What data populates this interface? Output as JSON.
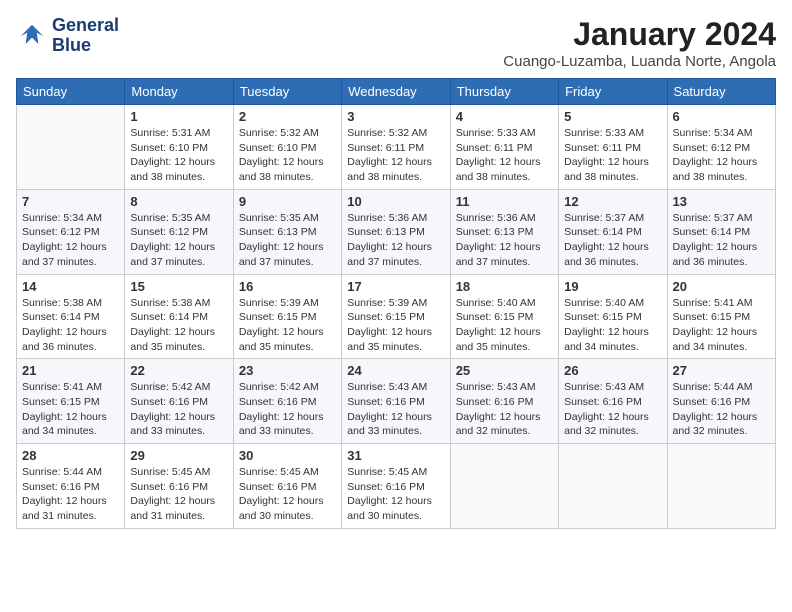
{
  "logo": {
    "line1": "General",
    "line2": "Blue"
  },
  "title": "January 2024",
  "location": "Cuango-Luzamba, Luanda Norte, Angola",
  "days_of_week": [
    "Sunday",
    "Monday",
    "Tuesday",
    "Wednesday",
    "Thursday",
    "Friday",
    "Saturday"
  ],
  "weeks": [
    [
      {
        "day": "",
        "sunrise": "",
        "sunset": "",
        "daylight": ""
      },
      {
        "day": "1",
        "sunrise": "Sunrise: 5:31 AM",
        "sunset": "Sunset: 6:10 PM",
        "daylight": "Daylight: 12 hours and 38 minutes."
      },
      {
        "day": "2",
        "sunrise": "Sunrise: 5:32 AM",
        "sunset": "Sunset: 6:10 PM",
        "daylight": "Daylight: 12 hours and 38 minutes."
      },
      {
        "day": "3",
        "sunrise": "Sunrise: 5:32 AM",
        "sunset": "Sunset: 6:11 PM",
        "daylight": "Daylight: 12 hours and 38 minutes."
      },
      {
        "day": "4",
        "sunrise": "Sunrise: 5:33 AM",
        "sunset": "Sunset: 6:11 PM",
        "daylight": "Daylight: 12 hours and 38 minutes."
      },
      {
        "day": "5",
        "sunrise": "Sunrise: 5:33 AM",
        "sunset": "Sunset: 6:11 PM",
        "daylight": "Daylight: 12 hours and 38 minutes."
      },
      {
        "day": "6",
        "sunrise": "Sunrise: 5:34 AM",
        "sunset": "Sunset: 6:12 PM",
        "daylight": "Daylight: 12 hours and 38 minutes."
      }
    ],
    [
      {
        "day": "7",
        "sunrise": "Sunrise: 5:34 AM",
        "sunset": "Sunset: 6:12 PM",
        "daylight": "Daylight: 12 hours and 37 minutes."
      },
      {
        "day": "8",
        "sunrise": "Sunrise: 5:35 AM",
        "sunset": "Sunset: 6:12 PM",
        "daylight": "Daylight: 12 hours and 37 minutes."
      },
      {
        "day": "9",
        "sunrise": "Sunrise: 5:35 AM",
        "sunset": "Sunset: 6:13 PM",
        "daylight": "Daylight: 12 hours and 37 minutes."
      },
      {
        "day": "10",
        "sunrise": "Sunrise: 5:36 AM",
        "sunset": "Sunset: 6:13 PM",
        "daylight": "Daylight: 12 hours and 37 minutes."
      },
      {
        "day": "11",
        "sunrise": "Sunrise: 5:36 AM",
        "sunset": "Sunset: 6:13 PM",
        "daylight": "Daylight: 12 hours and 37 minutes."
      },
      {
        "day": "12",
        "sunrise": "Sunrise: 5:37 AM",
        "sunset": "Sunset: 6:14 PM",
        "daylight": "Daylight: 12 hours and 36 minutes."
      },
      {
        "day": "13",
        "sunrise": "Sunrise: 5:37 AM",
        "sunset": "Sunset: 6:14 PM",
        "daylight": "Daylight: 12 hours and 36 minutes."
      }
    ],
    [
      {
        "day": "14",
        "sunrise": "Sunrise: 5:38 AM",
        "sunset": "Sunset: 6:14 PM",
        "daylight": "Daylight: 12 hours and 36 minutes."
      },
      {
        "day": "15",
        "sunrise": "Sunrise: 5:38 AM",
        "sunset": "Sunset: 6:14 PM",
        "daylight": "Daylight: 12 hours and 35 minutes."
      },
      {
        "day": "16",
        "sunrise": "Sunrise: 5:39 AM",
        "sunset": "Sunset: 6:15 PM",
        "daylight": "Daylight: 12 hours and 35 minutes."
      },
      {
        "day": "17",
        "sunrise": "Sunrise: 5:39 AM",
        "sunset": "Sunset: 6:15 PM",
        "daylight": "Daylight: 12 hours and 35 minutes."
      },
      {
        "day": "18",
        "sunrise": "Sunrise: 5:40 AM",
        "sunset": "Sunset: 6:15 PM",
        "daylight": "Daylight: 12 hours and 35 minutes."
      },
      {
        "day": "19",
        "sunrise": "Sunrise: 5:40 AM",
        "sunset": "Sunset: 6:15 PM",
        "daylight": "Daylight: 12 hours and 34 minutes."
      },
      {
        "day": "20",
        "sunrise": "Sunrise: 5:41 AM",
        "sunset": "Sunset: 6:15 PM",
        "daylight": "Daylight: 12 hours and 34 minutes."
      }
    ],
    [
      {
        "day": "21",
        "sunrise": "Sunrise: 5:41 AM",
        "sunset": "Sunset: 6:15 PM",
        "daylight": "Daylight: 12 hours and 34 minutes."
      },
      {
        "day": "22",
        "sunrise": "Sunrise: 5:42 AM",
        "sunset": "Sunset: 6:16 PM",
        "daylight": "Daylight: 12 hours and 33 minutes."
      },
      {
        "day": "23",
        "sunrise": "Sunrise: 5:42 AM",
        "sunset": "Sunset: 6:16 PM",
        "daylight": "Daylight: 12 hours and 33 minutes."
      },
      {
        "day": "24",
        "sunrise": "Sunrise: 5:43 AM",
        "sunset": "Sunset: 6:16 PM",
        "daylight": "Daylight: 12 hours and 33 minutes."
      },
      {
        "day": "25",
        "sunrise": "Sunrise: 5:43 AM",
        "sunset": "Sunset: 6:16 PM",
        "daylight": "Daylight: 12 hours and 32 minutes."
      },
      {
        "day": "26",
        "sunrise": "Sunrise: 5:43 AM",
        "sunset": "Sunset: 6:16 PM",
        "daylight": "Daylight: 12 hours and 32 minutes."
      },
      {
        "day": "27",
        "sunrise": "Sunrise: 5:44 AM",
        "sunset": "Sunset: 6:16 PM",
        "daylight": "Daylight: 12 hours and 32 minutes."
      }
    ],
    [
      {
        "day": "28",
        "sunrise": "Sunrise: 5:44 AM",
        "sunset": "Sunset: 6:16 PM",
        "daylight": "Daylight: 12 hours and 31 minutes."
      },
      {
        "day": "29",
        "sunrise": "Sunrise: 5:45 AM",
        "sunset": "Sunset: 6:16 PM",
        "daylight": "Daylight: 12 hours and 31 minutes."
      },
      {
        "day": "30",
        "sunrise": "Sunrise: 5:45 AM",
        "sunset": "Sunset: 6:16 PM",
        "daylight": "Daylight: 12 hours and 30 minutes."
      },
      {
        "day": "31",
        "sunrise": "Sunrise: 5:45 AM",
        "sunset": "Sunset: 6:16 PM",
        "daylight": "Daylight: 12 hours and 30 minutes."
      },
      {
        "day": "",
        "sunrise": "",
        "sunset": "",
        "daylight": ""
      },
      {
        "day": "",
        "sunrise": "",
        "sunset": "",
        "daylight": ""
      },
      {
        "day": "",
        "sunrise": "",
        "sunset": "",
        "daylight": ""
      }
    ]
  ]
}
